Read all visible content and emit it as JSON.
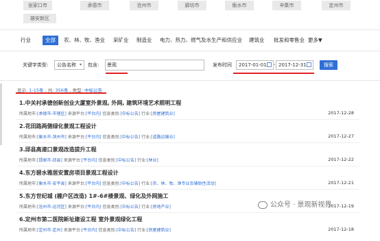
{
  "cities": [
    "张家口市",
    "承德市",
    "沧州市",
    "廊坊市",
    "衡水市",
    "辛集市",
    "定州市",
    "雄安新区"
  ],
  "industry": {
    "label": "行业",
    "all": "全部",
    "items": [
      "农、林、牧、渔业",
      "采矿业",
      "制造业",
      "电力、热力、燃气及水生产和供应业",
      "建筑业",
      "批发和零售业",
      "更多▼"
    ]
  },
  "search": {
    "keyword_type_label": "关键字类型:",
    "keyword_type_value": "公告名称",
    "contains_label": "包含:",
    "keyword": "景观",
    "publish_time_label": "发布时间",
    "date_from": "2017-01-01",
    "date_to": "2017-12-31",
    "button": "搜索"
  },
  "summary": {
    "shown_label": "显示:",
    "shown_value": "1-15条",
    "total_label": ", 共:",
    "total_value": "356条",
    "type_label": ", 类型:",
    "type_value": "中标公告"
  },
  "results": [
    {
      "title": "1.中关村承德创新创业大厦室外景观, 外网, 建筑环境艺术照明工程",
      "region": "[承德市-市辖区]",
      "platform": "[平台内]",
      "category": "[中标公告]",
      "industry": "[房屋建筑业]",
      "date": "2017-12-28"
    },
    {
      "title": "2.花田路两侧绿化景观工程设计",
      "region": "[衡水市-滨州市]",
      "platform": "[平台内]",
      "category": "[中标公告]",
      "industry": "[道路运输业]",
      "date": "2017-12-27"
    },
    {
      "title": "3.邱县高速口景观改造提升工程",
      "region": "[邯郸市-邱县]",
      "platform": "[平台内]",
      "category": "[中标公告]",
      "industry": "[林业]",
      "date": "2017-12-22"
    },
    {
      "title": "4.东方碧水雅居安置房项目景观工程设计",
      "region": "[衡水市-安平县]",
      "platform": "[平台内]",
      "category": "[中标公告]",
      "industry": "[农、林、牧、渔专业及辅助性活动]",
      "date": "2017-12-21"
    },
    {
      "title": "5.东方世纪城 (棚户区改造) 1#-6#楼景观、绿化及外网施工",
      "region": "[沧州市-运河区]",
      "platform": "[平台内]",
      "category": "[中标公告]",
      "industry": "[房地产业]",
      "date": "2017-12-19"
    },
    {
      "title": "6.定州市第二医院新址建设工程 室外景观绿化工程",
      "region": "[定州市-定州]",
      "platform": "[平台内]",
      "category": "[中标公告]",
      "industry": "[房屋建筑业]",
      "date": "2017-12-18"
    }
  ],
  "meta_labels": {
    "region": "所属地市:",
    "platform": "来源平台:",
    "category": "信息类别:",
    "industry": "行业:"
  },
  "watermark": "公众号 · 景观新视界",
  "colors": {
    "accent": "#2f6fd6",
    "highlight": "#e02020"
  }
}
